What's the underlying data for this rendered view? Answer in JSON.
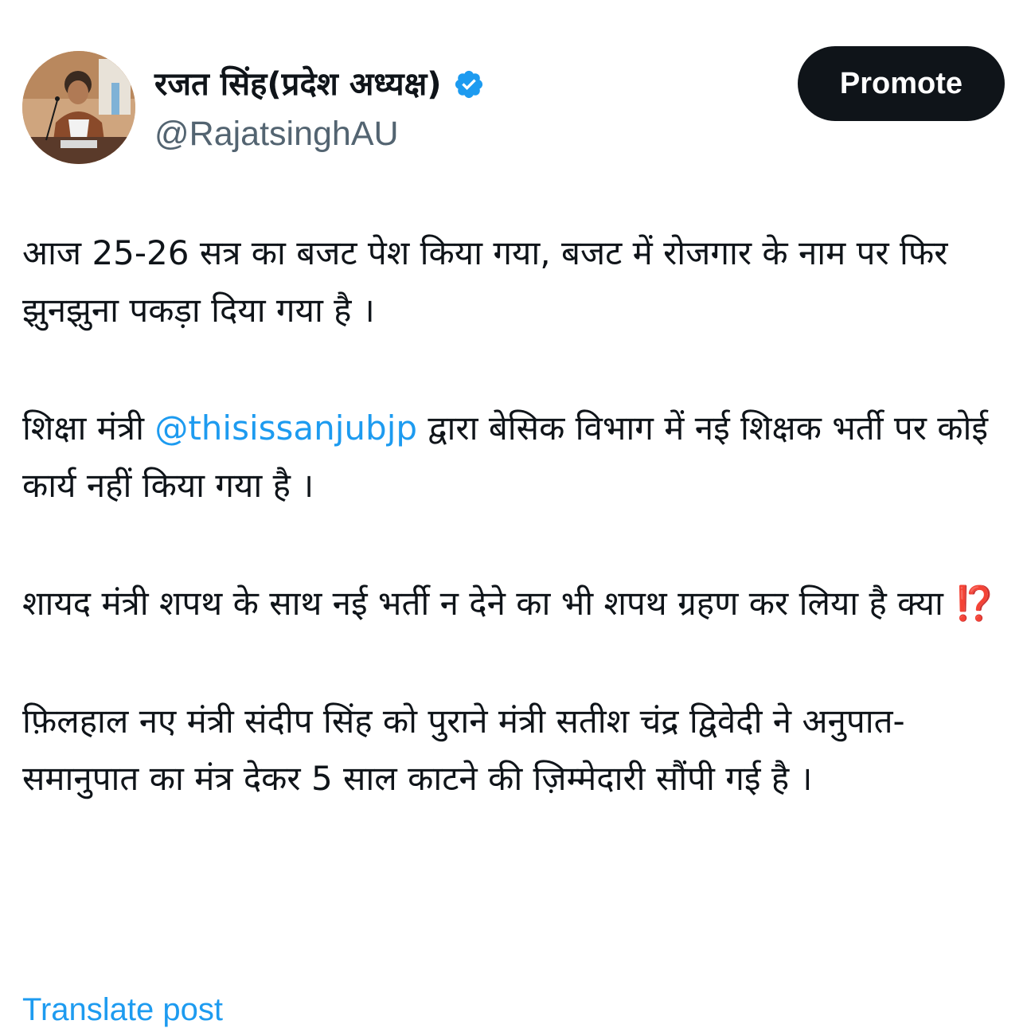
{
  "author": {
    "display_name": "रजत सिंह(प्रदेश अध्यक्ष)",
    "handle": "@RajatsinghAU",
    "verified_icon": "verified-badge-icon",
    "avatar": "profile-photo"
  },
  "actions": {
    "promote_label": "Promote"
  },
  "post": {
    "para1": "आज 25-26 सत्र का बजट पेश किया गया, बजट में रोजगार के नाम पर फिर झुनझुना पकड़ा दिया गया है ।",
    "para2_before": "शिक्षा मंत्री ",
    "para2_mention": "@thisissanjubjp",
    "para2_after": " द्वारा बेसिक विभाग में नई शिक्षक भर्ती पर कोई कार्य नहीं किया गया है ।",
    "para3_text": "शायद मंत्री शपथ के साथ नई भर्ती न देने का भी शपथ ग्रहण कर लिया है क्या ",
    "para3_emoji": "⁉️",
    "para4": "फ़िलहाल नए मंत्री संदीप सिंह को पुराने मंत्री सतीश चंद्र द्विवेदी ने अनुपात- समानुपात का मंत्र देकर 5 साल काटने की ज़िम्मेदारी सौंपी गई है ।"
  },
  "footer": {
    "translate_label": "Translate post"
  },
  "colors": {
    "text": "#0f1419",
    "secondary": "#536471",
    "link": "#1d9bf0",
    "button_bg": "#0f1419",
    "button_text": "#ffffff"
  }
}
